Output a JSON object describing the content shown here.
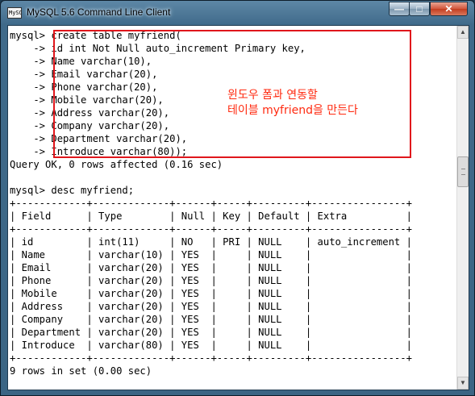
{
  "window": {
    "title": "MySQL 5.6 Command Line Client",
    "icon_label": "MySQL",
    "controls": {
      "minimize": "—",
      "maximize": "□",
      "close": "✕"
    }
  },
  "console": {
    "create_lines": [
      "mysql> create table myfriend(",
      "    -> id int Not Null auto_increment Primary key,",
      "    -> Name varchar(10),",
      "    -> Email varchar(20),",
      "    -> Phone varchar(20),",
      "    -> Mobile varchar(20),",
      "    -> Address varchar(20),",
      "    -> Company varchar(20),",
      "    -> Department varchar(20),",
      "    -> Introduce varchar(80));"
    ],
    "create_result": "Query OK, 0 rows affected (0.16 sec)",
    "desc_command": "mysql> desc myfriend;",
    "table": {
      "columns": [
        "Field",
        "Type",
        "Null",
        "Key",
        "Default",
        "Extra"
      ],
      "rows": [
        [
          "id",
          "int(11)",
          "NO",
          "PRI",
          "NULL",
          "auto_increment"
        ],
        [
          "Name",
          "varchar(10)",
          "YES",
          "",
          "NULL",
          ""
        ],
        [
          "Email",
          "varchar(20)",
          "YES",
          "",
          "NULL",
          ""
        ],
        [
          "Phone",
          "varchar(20)",
          "YES",
          "",
          "NULL",
          ""
        ],
        [
          "Mobile",
          "varchar(20)",
          "YES",
          "",
          "NULL",
          ""
        ],
        [
          "Address",
          "varchar(20)",
          "YES",
          "",
          "NULL",
          ""
        ],
        [
          "Company",
          "varchar(20)",
          "YES",
          "",
          "NULL",
          ""
        ],
        [
          "Department",
          "varchar(20)",
          "YES",
          "",
          "NULL",
          ""
        ],
        [
          "Introduce",
          "varchar(80)",
          "YES",
          "",
          "NULL",
          ""
        ]
      ]
    },
    "desc_result": "9 rows in set (0.00 sec)"
  },
  "annotation": {
    "line1": "윈도우 폼과 연동할",
    "line2": "테이블 myfriend을 만든다"
  },
  "scrollbar": {
    "up_arrow": "▲",
    "down_arrow": "▼"
  },
  "colors": {
    "annotation": "#ff2a10",
    "highlight_border": "#e0161c"
  }
}
